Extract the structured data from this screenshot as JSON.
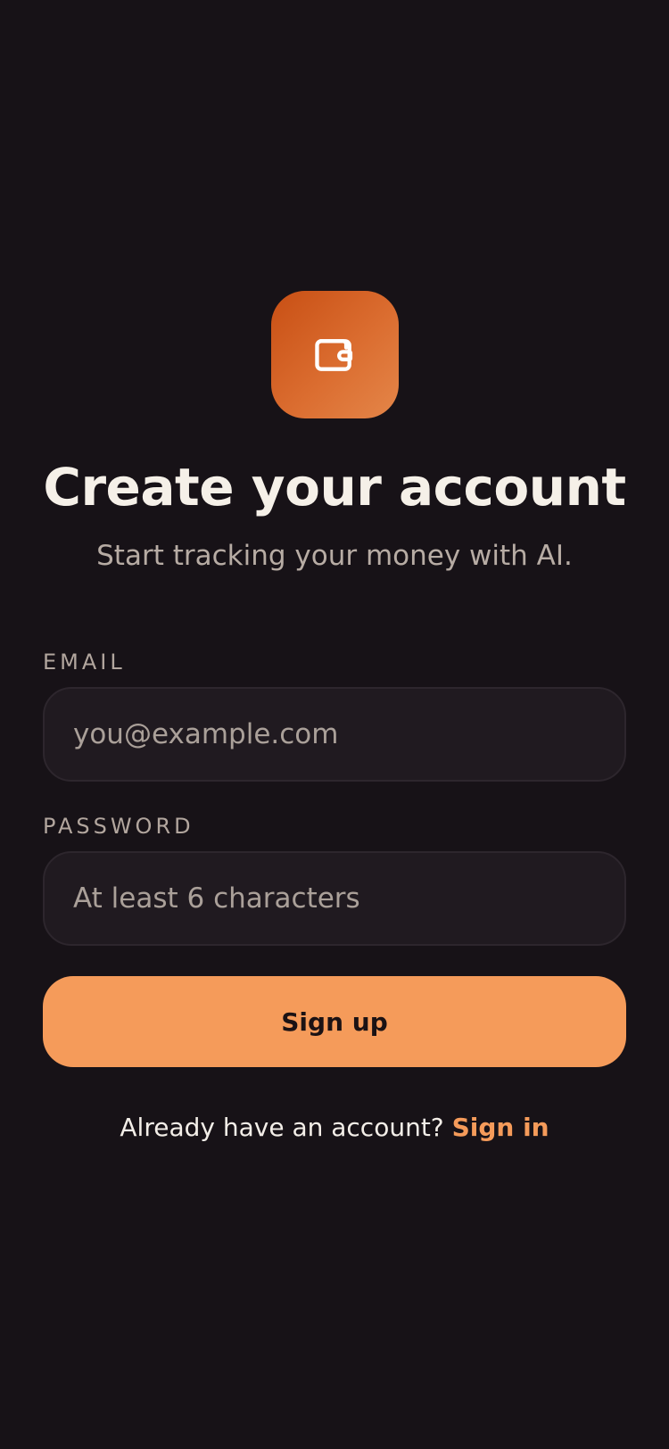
{
  "header": {
    "icon": "wallet-icon",
    "title": "Create your account",
    "subtitle": "Start tracking your money with AI."
  },
  "form": {
    "email": {
      "label": "EMAIL",
      "placeholder": "you@example.com",
      "value": ""
    },
    "password": {
      "label": "PASSWORD",
      "placeholder": "At least 6 characters",
      "value": ""
    },
    "submit_label": "Sign up"
  },
  "footer": {
    "prompt": "Already have an account?",
    "link_label": "Sign in"
  },
  "colors": {
    "background": "#171217",
    "accent": "#f59b5a",
    "logo_gradient_start": "#c84f14",
    "logo_gradient_end": "#e48649",
    "field_background": "#201a20",
    "muted_text": "#b7aca4"
  }
}
